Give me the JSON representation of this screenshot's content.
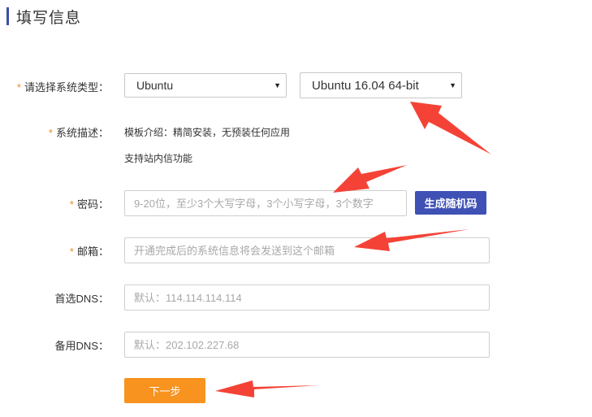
{
  "page": {
    "title": "填写信息"
  },
  "form": {
    "required_mark": "*",
    "os_type": {
      "label": "请选择系统类型：",
      "selected": "Ubuntu"
    },
    "os_version": {
      "selected": "Ubuntu 16.04 64-bit"
    },
    "description": {
      "label": "系统描述：",
      "line1": "模板介绍：精简安装，无预装任何应用",
      "line2": "支持站内信功能"
    },
    "password": {
      "label": "密码：",
      "placeholder": "9-20位，至少3个大写字母，3个小写字母，3个数字",
      "generate_label": "生成随机码"
    },
    "email": {
      "label": "邮箱：",
      "placeholder": "开通完成后的系统信息将会发送到这个邮箱"
    },
    "dns_primary": {
      "label": "首选DNS：",
      "placeholder": "默认：114.114.114.114"
    },
    "dns_secondary": {
      "label": "备用DNS：",
      "placeholder": "默认：202.102.227.68"
    },
    "next_label": "下一步"
  },
  "colors": {
    "accent": "#3f51b5",
    "next_button": "#f7931e",
    "required": "#f08a24",
    "annotation_arrow": "#f44336"
  }
}
